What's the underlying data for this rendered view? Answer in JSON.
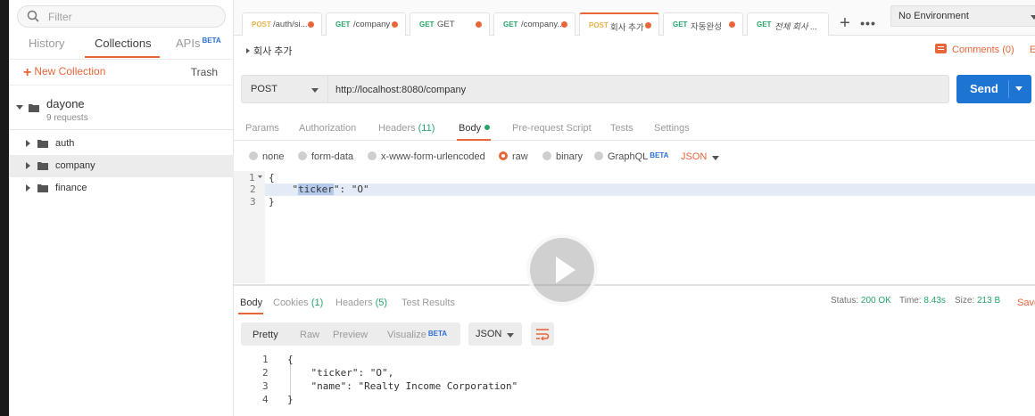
{
  "sidebar": {
    "filter_placeholder": "Filter",
    "tabs": [
      {
        "label": "History"
      },
      {
        "label": "Collections"
      },
      {
        "label": "APIs",
        "badge": "BETA"
      }
    ],
    "new_collection": "New Collection",
    "trash": "Trash",
    "collection": {
      "name": "dayone",
      "count": "9 requests"
    },
    "folders": [
      {
        "label": "auth"
      },
      {
        "label": "company"
      },
      {
        "label": "finance"
      }
    ]
  },
  "request_tabs": [
    {
      "method": "POST",
      "name": "/auth/si..."
    },
    {
      "method": "GET",
      "name": "/company"
    },
    {
      "method": "GET",
      "name": "GET"
    },
    {
      "method": "GET",
      "name": "/company..."
    },
    {
      "method": "POST",
      "name": "회사 추가"
    },
    {
      "method": "GET",
      "name": "자동완성"
    },
    {
      "method": "GET",
      "name": "전체 회사 ..."
    }
  ],
  "environment": "No Environment",
  "request": {
    "title": "회사 추가",
    "comments": "Comments (0)",
    "ex": "Ex",
    "method": "POST",
    "url": "http://localhost:8080/company",
    "send": "Send"
  },
  "request_subtabs": {
    "params": "Params",
    "authorization": "Authorization",
    "headers": "Headers",
    "headers_count": "(11)",
    "body": "Body",
    "pre_request": "Pre-request Script",
    "tests": "Tests",
    "settings": "Settings"
  },
  "body_types": {
    "none": "none",
    "form_data": "form-data",
    "urlencoded": "x-www-form-urlencoded",
    "raw": "raw",
    "binary": "binary",
    "graphql": "GraphQL",
    "graphql_badge": "BETA",
    "format": "JSON"
  },
  "editor": {
    "lines": [
      {
        "num": "1",
        "text": "{"
      },
      {
        "num": "2",
        "text_pre": "    \"",
        "text_sel": "ticker",
        "text_post": "\": \"O\""
      },
      {
        "num": "3",
        "text": "}"
      }
    ]
  },
  "response_tabs": {
    "body": "Body",
    "cookies": "Cookies",
    "cookies_count": "(1)",
    "headers": "Headers",
    "headers_count": "(5)",
    "test_results": "Test Results",
    "status_label": "Status:",
    "status_value": "200 OK",
    "time_label": "Time:",
    "time_value": "8.43s",
    "size_label": "Size:",
    "size_value": "213 B",
    "save": "Save"
  },
  "response_views": {
    "pretty": "Pretty",
    "raw": "Raw",
    "preview": "Preview",
    "visualize": "Visualize",
    "visualize_badge": "BETA",
    "format": "JSON"
  },
  "response_body": [
    {
      "num": "1",
      "text": "{"
    },
    {
      "num": "2",
      "text": "    \"ticker\": \"O\","
    },
    {
      "num": "3",
      "text": "    \"name\": \"Realty Income Corporation\""
    },
    {
      "num": "4",
      "text": "}"
    }
  ],
  "colors": {
    "accent": "#e8663a",
    "send": "#1d74d3",
    "get": "#26a56a",
    "post": "#e8b24a"
  }
}
